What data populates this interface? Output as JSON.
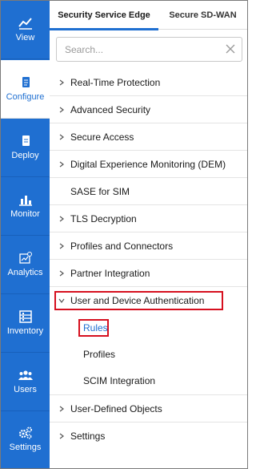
{
  "nav": {
    "items": [
      {
        "key": "view",
        "label": "View",
        "icon": "chart-icon",
        "active": false
      },
      {
        "key": "configure",
        "label": "Configure",
        "icon": "document-icon",
        "active": true
      },
      {
        "key": "deploy",
        "label": "Deploy",
        "icon": "file-icon",
        "active": false
      },
      {
        "key": "monitor",
        "label": "Monitor",
        "icon": "bar-chart-icon",
        "active": false
      },
      {
        "key": "analytics",
        "label": "Analytics",
        "icon": "analytics-icon",
        "active": false
      },
      {
        "key": "inventory",
        "label": "Inventory",
        "icon": "inventory-icon",
        "active": false
      },
      {
        "key": "users",
        "label": "Users",
        "icon": "users-icon",
        "active": false
      },
      {
        "key": "settings",
        "label": "Settings",
        "icon": "gears-icon",
        "active": false
      }
    ]
  },
  "tabs": [
    {
      "label": "Security Service Edge",
      "active": true
    },
    {
      "label": "Secure SD-WAN",
      "active": false
    }
  ],
  "search": {
    "placeholder": "Search..."
  },
  "menu": {
    "realtime": "Real-Time Protection",
    "advanced": "Advanced Security",
    "secure_access": "Secure Access",
    "dem": "Digital Experience Monitoring (DEM)",
    "sase_sim": "SASE for SIM",
    "tls": "TLS Decryption",
    "profiles_connectors": "Profiles and Connectors",
    "partner": "Partner Integration",
    "user_device_auth": "User and Device Authentication",
    "rules": "Rules",
    "profiles": "Profiles",
    "scim": "SCIM Integration",
    "user_defined": "User-Defined Objects",
    "settings": "Settings"
  },
  "colors": {
    "accent": "#1f6fd1",
    "highlight": "#d6101f"
  }
}
